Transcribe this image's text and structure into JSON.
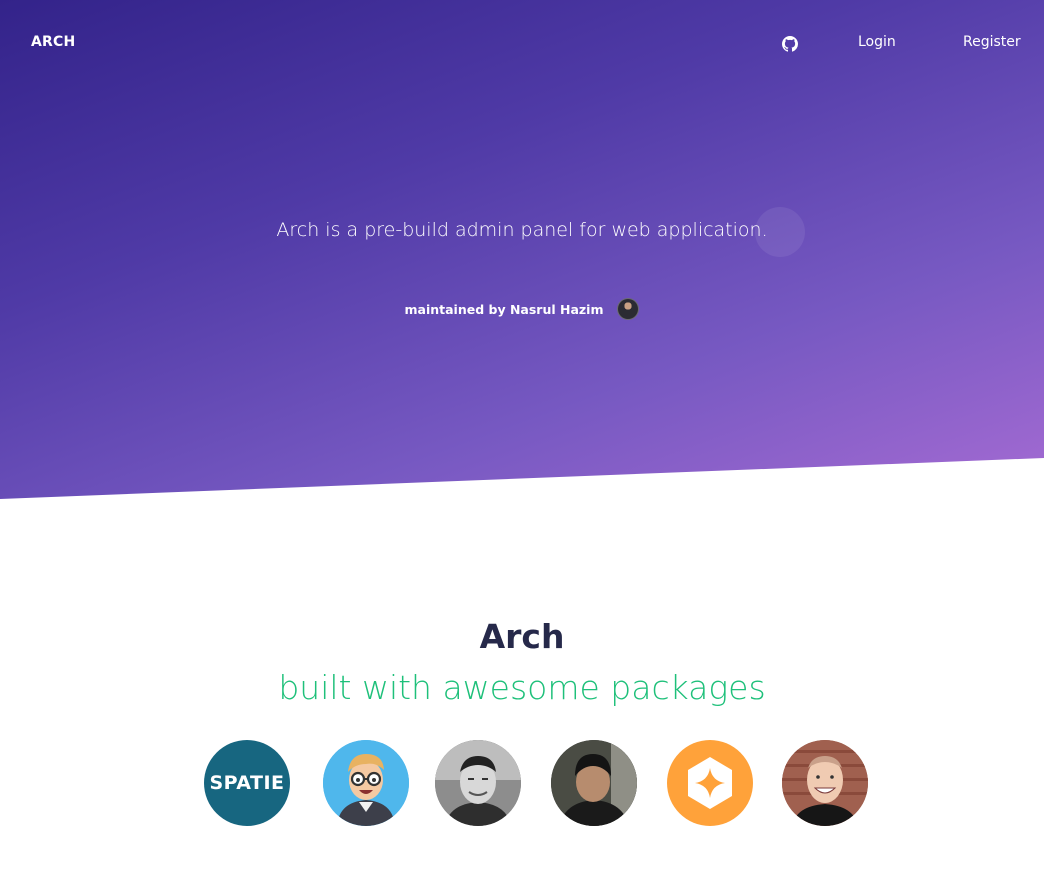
{
  "nav": {
    "brand": "ARCH",
    "github_icon": "github-icon",
    "login": "Login",
    "register": "Register"
  },
  "hero": {
    "tagline": "Arch is a pre-build admin panel for web application.",
    "maintainer": "maintained by Nasrul Hazim"
  },
  "section": {
    "title": "Arch",
    "subtitle": "built with awesome packages"
  },
  "packages": {
    "spatie_logo_text": "SPATIE"
  },
  "colors": {
    "hero_start": "#33238a",
    "hero_end": "#a56bd3",
    "title": "#26294a",
    "accent_green": "#1ec07a",
    "spatie_teal": "#176680",
    "orange": "#ffa23a"
  }
}
